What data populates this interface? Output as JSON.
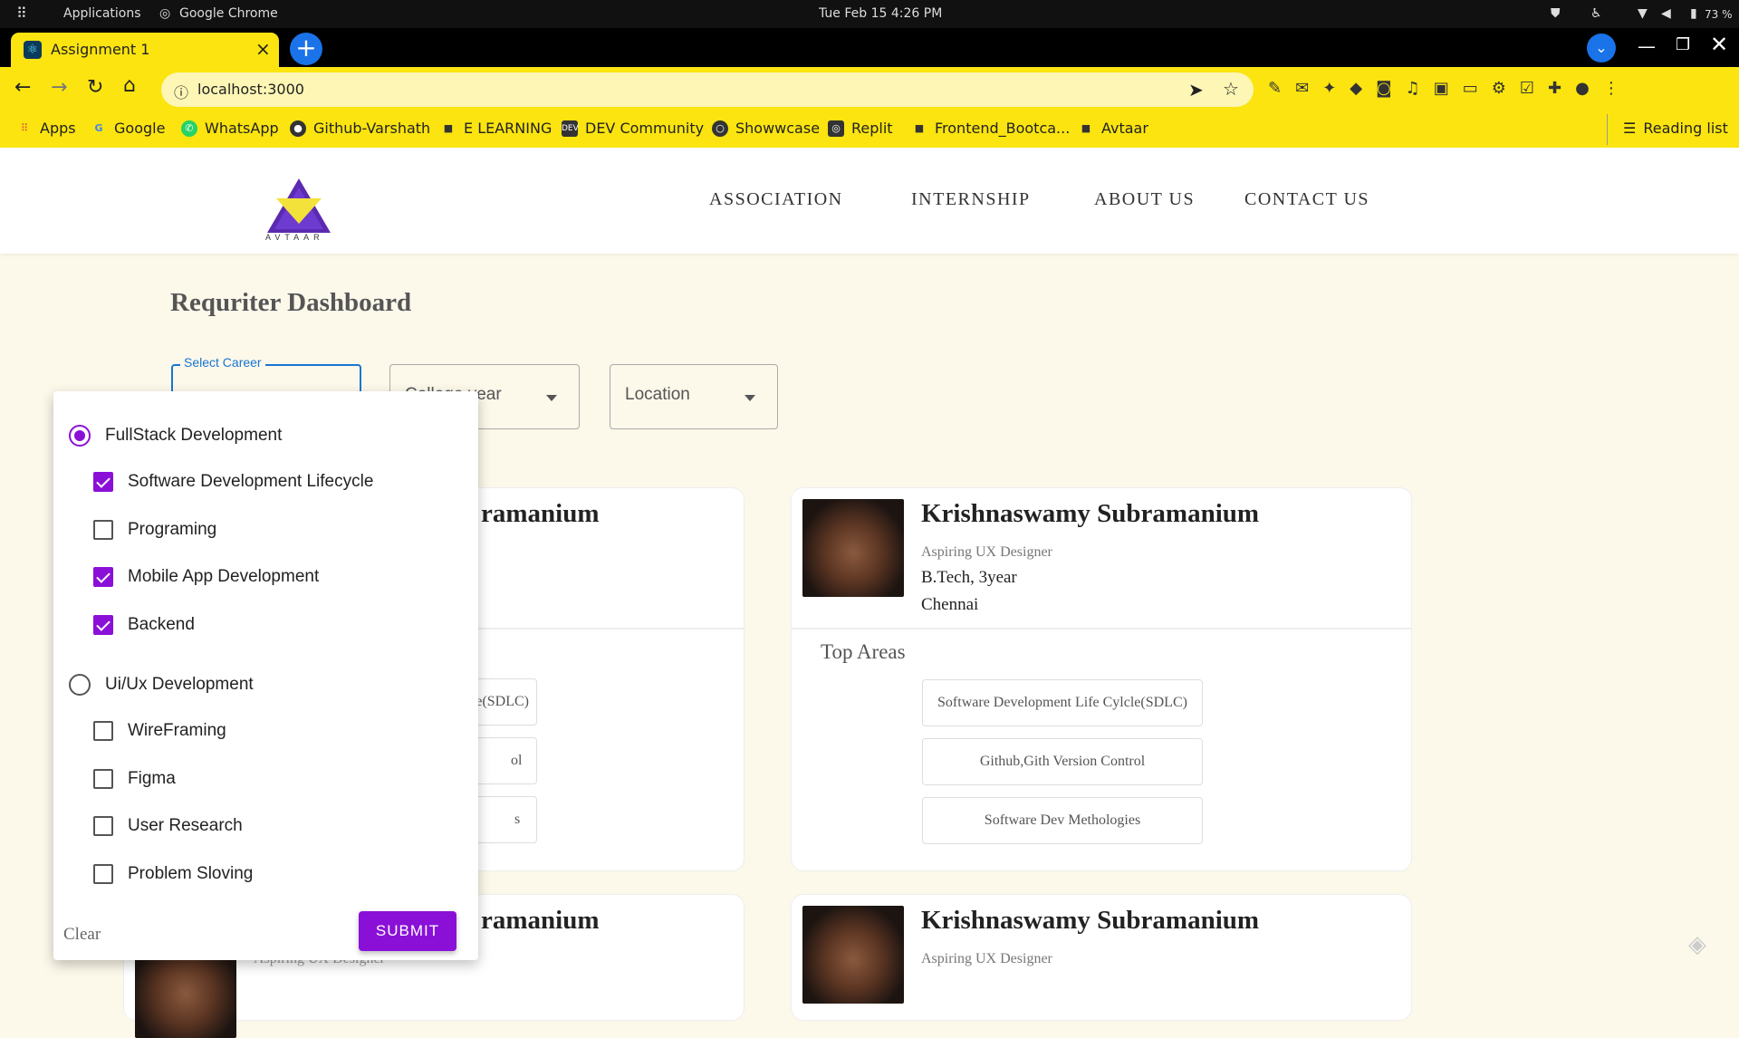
{
  "os": {
    "applications": "Applications",
    "browser": "Google Chrome",
    "datetime": "Tue Feb 15   4:26 PM",
    "battery": "73 %"
  },
  "browser": {
    "tab_title": "Assignment 1",
    "url": "localhost:3000",
    "bookmarks": [
      {
        "label": "Apps",
        "icon": "apps-grid-icon"
      },
      {
        "label": "Google",
        "icon": "google-icon"
      },
      {
        "label": "WhatsApp",
        "icon": "whatsapp-icon"
      },
      {
        "label": "Github-Varshath",
        "icon": "github-icon"
      },
      {
        "label": "E LEARNING",
        "icon": "folder-icon"
      },
      {
        "label": "DEV Community",
        "icon": "dev-icon"
      },
      {
        "label": "Showwcase",
        "icon": "showwcase-icon"
      },
      {
        "label": "Replit",
        "icon": "replit-icon"
      },
      {
        "label": "Frontend_Bootca...",
        "icon": "folder-icon"
      },
      {
        "label": "Avtaar",
        "icon": "folder-icon"
      }
    ],
    "reading_list": "Reading list"
  },
  "site": {
    "logo_text": "AVTAAR",
    "nav": [
      "ASSOCIATION",
      "INTERNSHIP",
      "ABOUT US",
      "CONTACT US"
    ],
    "title": "Requriter Dashboard"
  },
  "filters": {
    "career_label": "Select Career",
    "college_year": "College year",
    "location": "Location"
  },
  "menu": {
    "groups": [
      {
        "label": "FullStack Development",
        "selected": true,
        "items": [
          {
            "label": "Software Development Lifecycle",
            "checked": true
          },
          {
            "label": "Programing",
            "checked": false
          },
          {
            "label": "Mobile App Development",
            "checked": true
          },
          {
            "label": "Backend",
            "checked": true
          }
        ]
      },
      {
        "label": "Ui/Ux Development",
        "selected": false,
        "items": [
          {
            "label": "WireFraming",
            "checked": false
          },
          {
            "label": "Figma",
            "checked": false
          },
          {
            "label": "User Research",
            "checked": false
          },
          {
            "label": "Problem Sloving",
            "checked": false
          }
        ]
      }
    ],
    "clear": "Clear",
    "submit": "SUBMIT"
  },
  "cards": {
    "left_name_partial": "ramanium",
    "left_chip_partials": [
      "e(SDLC)",
      "ol",
      "s"
    ],
    "right": {
      "name": "Krishnaswamy Subramanium",
      "role": "Aspiring UX Designer",
      "education": "B.Tech, 3year",
      "location": "Chennai",
      "top_areas_label": "Top Areas",
      "areas": [
        "Software Development Life Cylcle(SDLC)",
        "Github,Gith Version Control",
        "Software Dev Methologies"
      ]
    },
    "bottom_left_name_partial": "ramanium",
    "bottom_right_name": "Krishnaswamy Subramanium",
    "bottom_right_role": "Aspiring UX Designer",
    "bottom_left_role_partial": "Aspiring UX Designer"
  }
}
